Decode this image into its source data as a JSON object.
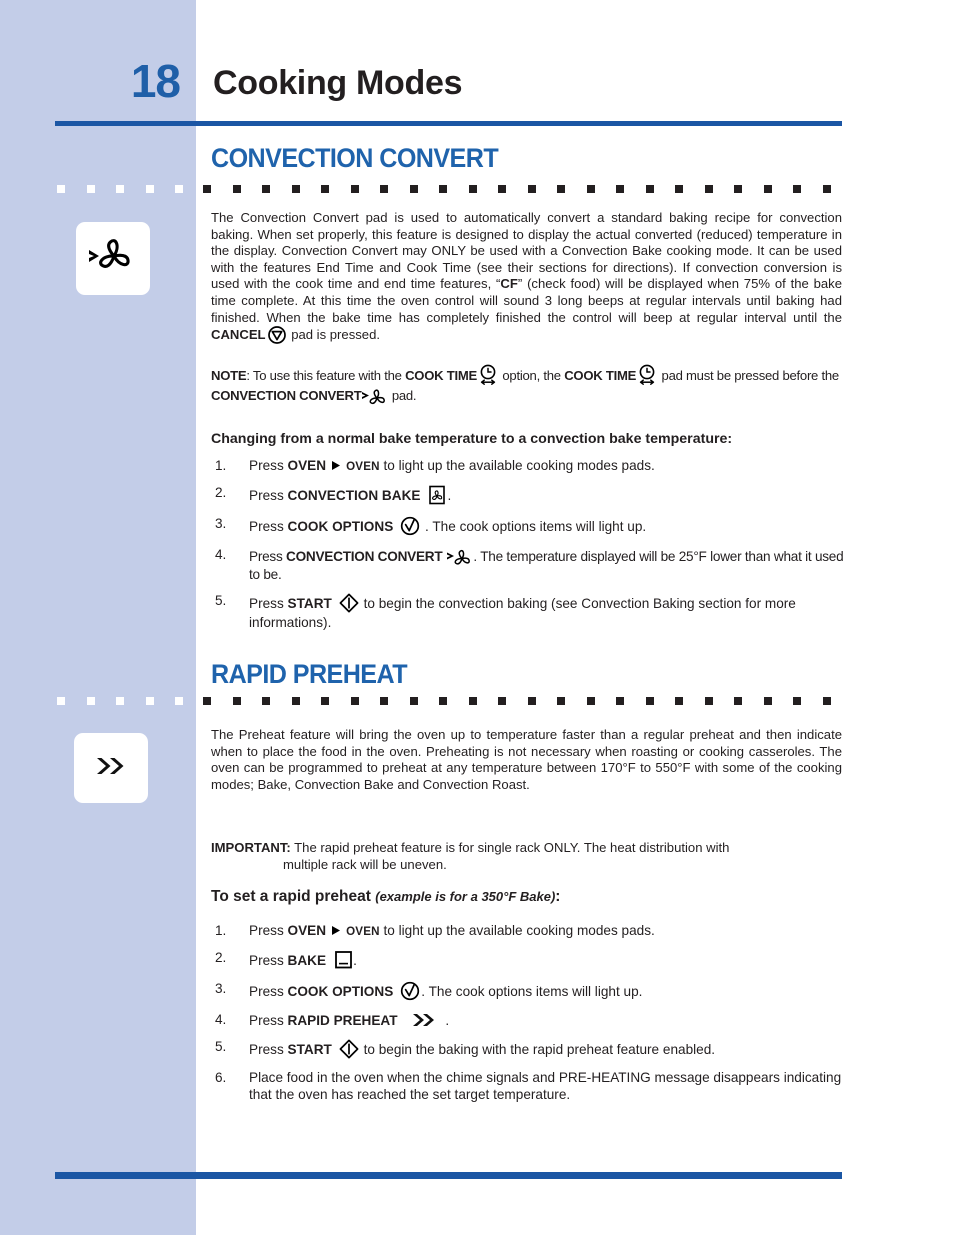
{
  "page": {
    "number": "18",
    "title": "Cooking Modes",
    "accent_color": "#1b56a4",
    "heading_color": "#1f63ac",
    "sidebar_color": "#c3cde8"
  },
  "sections": [
    {
      "id": "convection-convert",
      "heading": "CONVECTION CONVERT",
      "sidebar_icon": "convection-convert-icon",
      "body": {
        "p1_a": "The Convection Convert pad is used to automatically convert a standard baking recipe for convection baking. When set properly, this feature is designed to display the actual converted (reduced) temperature in the display. Convection Convert may ONLY be used with a Convection Bake cooking mode. It can be used with the features End Time and Cook Time (see their sections for directions). If convection conversion is used with the cook time and end time features,  “",
        "p1_cf": "CF",
        "p1_b": "” (check food) will be displayed when 75% of the bake time complete. At this time the oven control will sound 3 long beeps at regular intervals until baking had finished. When the bake time has completely finished the control will beep at regular interval until the ",
        "p1_cancel": "CANCEL",
        "p1_c": " pad is pressed.",
        "note_label": "NOTE",
        "note_a": ": To use this feature with the ",
        "note_cooktime1": "COOK TIME",
        "note_b": " option, the ",
        "note_cooktime2": "COOK TIME",
        "note_c": " pad must be pressed before the ",
        "note_cc": "CONVECTION CONVERT",
        "note_d": " pad."
      },
      "sub_heading": "Changing from a normal bake temperature to a convection bake temperature:",
      "steps": [
        {
          "num": "1.",
          "pre": "Press ",
          "bold": "OVEN",
          "icon": "play-triangle-icon",
          "bold2": "OVEN",
          "post": " to light up the available cooking modes pads."
        },
        {
          "num": "2.",
          "pre": "Press ",
          "bold": "CONVECTION BAKE",
          "icon": "convection-bake-icon",
          "post": "."
        },
        {
          "num": "3.",
          "pre": "Press ",
          "bold": "COOK OPTIONS",
          "icon": "cook-options-icon",
          "post": " . The cook options items will light up."
        },
        {
          "num": "4.",
          "pre": "Press ",
          "bold": "CONVECTION CONVERT",
          "icon": "convection-convert-icon",
          "post": ". The temperature displayed will be 25°F lower than what it used to be."
        },
        {
          "num": "5.",
          "pre": "Press ",
          "bold": "START",
          "icon": "start-icon",
          "post": " to begin the convection baking (see Convection Baking section for more informations)."
        }
      ]
    },
    {
      "id": "rapid-preheat",
      "heading": "RAPID PREHEAT",
      "sidebar_icon": "double-chevron-icon",
      "body": {
        "p1": "The Preheat feature will bring the oven up to temperature faster than a regular preheat and then indicate when to place the food in the oven. Preheating is not necessary when roasting or cooking casseroles. The oven can be programmed to preheat at any temperature between 170°F to 550°F with some of the cooking modes; Bake, Convection Bake and Convection Roast."
      },
      "important": {
        "label": "IMPORTANT:",
        "line1": " The rapid preheat feature is for single rack ONLY. The heat distribution with",
        "line2": "multiple rack will be uneven."
      },
      "sub_heading": "To set a rapid preheat",
      "sub_heading_italic": "(example is for a 350°F Bake)",
      "sub_heading_colon": ":",
      "steps": [
        {
          "num": "1.",
          "pre": "Press ",
          "bold": "OVEN",
          "icon": "play-triangle-icon",
          "bold2": "OVEN",
          "post": " to light up the available cooking modes pads."
        },
        {
          "num": "2.",
          "pre": "Press ",
          "bold": "BAKE",
          "icon": "bake-icon",
          "post": "."
        },
        {
          "num": "3.",
          "pre": "Press ",
          "bold": "COOK OPTIONS",
          "icon": "cook-options-icon",
          "post": ". The cook options items will light up."
        },
        {
          "num": "4.",
          "pre": "Press ",
          "bold": "RAPID PREHEAT",
          "icon": "double-chevron-icon",
          "post": " ."
        },
        {
          "num": "5.",
          "pre": "Press ",
          "bold": "START",
          "icon": "start-icon",
          "post": " to begin the baking with the rapid preheat feature enabled."
        },
        {
          "num": "6.",
          "pre": "Place food in the oven when the chime signals and PRE-HEATING message disappears indicating that the oven has reached the set target temperature.",
          "bold": "",
          "icon": "",
          "post": ""
        }
      ]
    }
  ]
}
